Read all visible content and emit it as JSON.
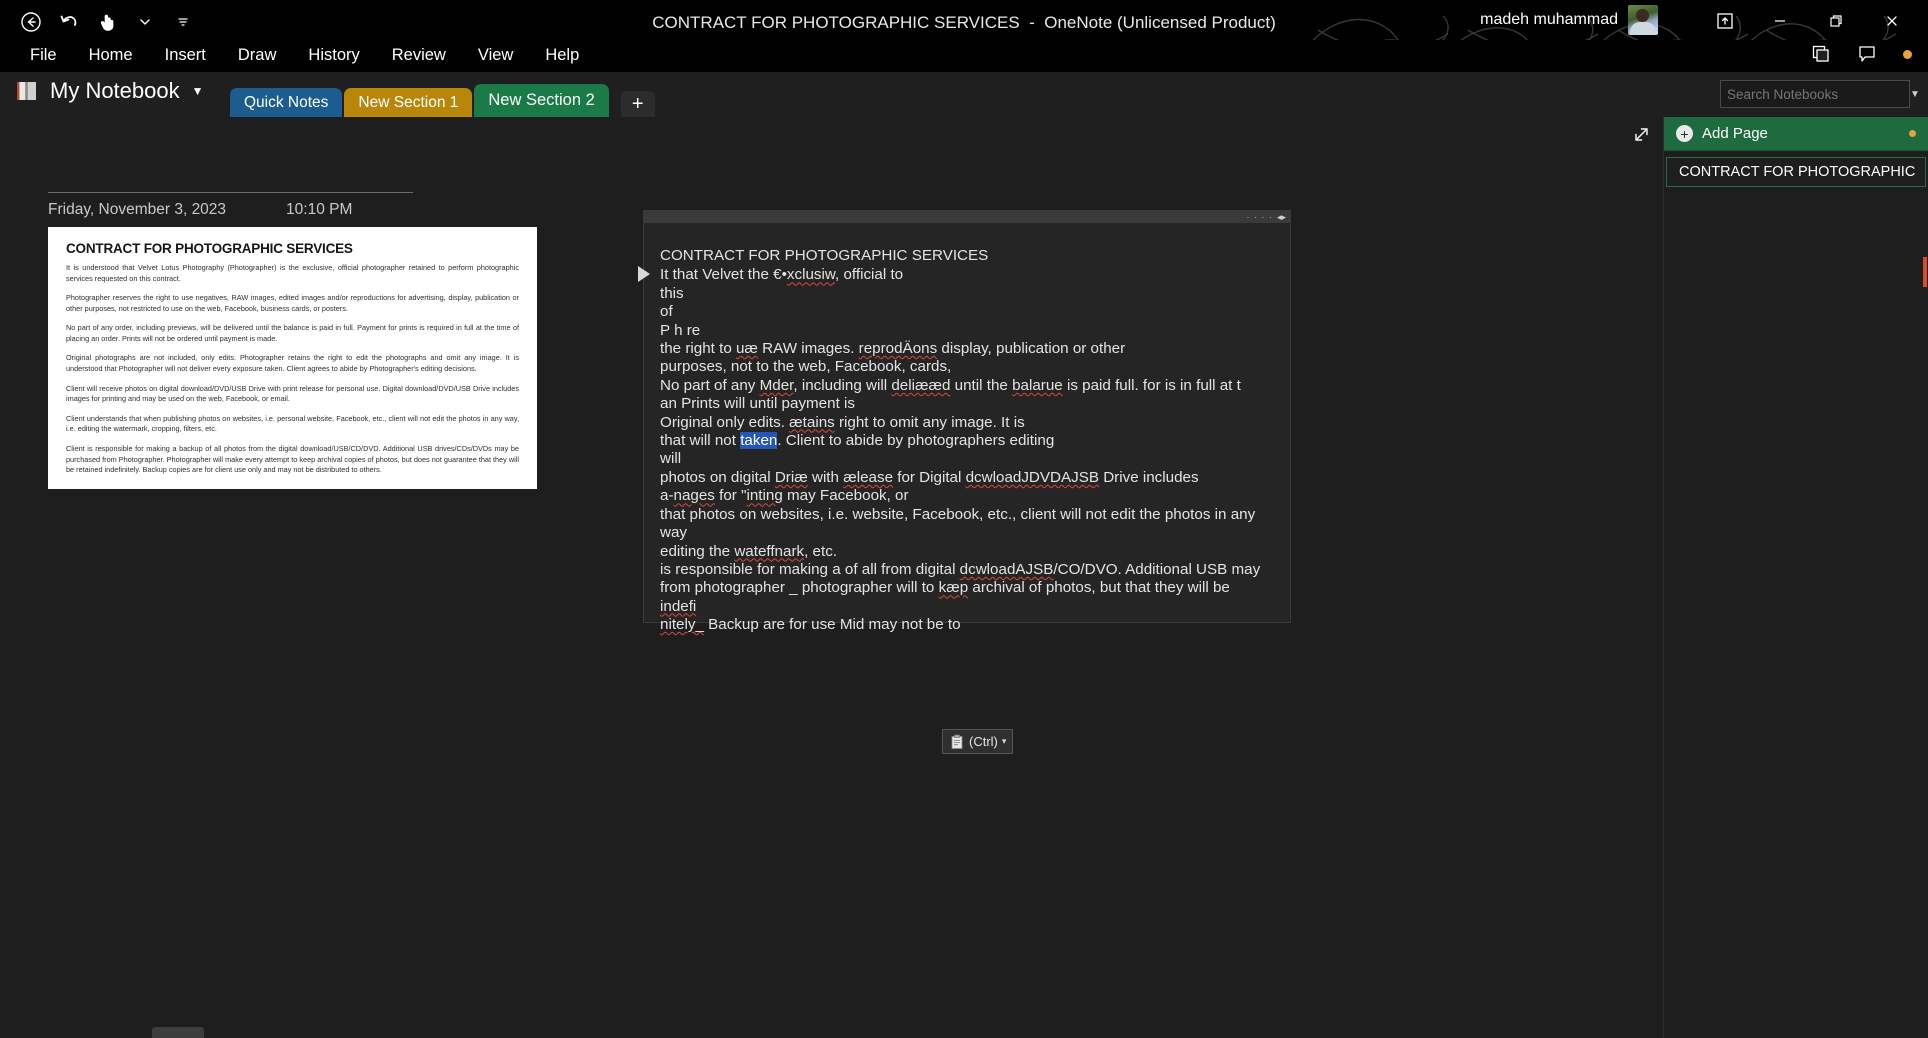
{
  "window": {
    "title": "CONTRACT FOR PHOTOGRAPHIC SERVICES  -  OneNote (Unlicensed Product)",
    "account_name": "madeh muhammad",
    "minimize_label": "Minimize",
    "restore_label": "Restore Down",
    "close_label": "Close",
    "ribbon_display_label": "Ribbon Display Options"
  },
  "quick_access": {
    "back_label": "Back",
    "undo_label": "Undo",
    "touch_mode_label": "Touch/Mouse Mode",
    "touch_caret_label": "Touch Mode Options",
    "customize_label": "Customize Quick Access Toolbar"
  },
  "menu": {
    "items": [
      {
        "label": "File"
      },
      {
        "label": "Home"
      },
      {
        "label": "Insert"
      },
      {
        "label": "Draw"
      },
      {
        "label": "History"
      },
      {
        "label": "Review"
      },
      {
        "label": "View"
      },
      {
        "label": "Help"
      }
    ]
  },
  "top_right_icons": {
    "share_label": "Share",
    "comments_label": "Comments",
    "status_dot_color": "#e8a33d"
  },
  "notebook": {
    "name": "My Notebook",
    "caret": "▼"
  },
  "sections": [
    {
      "label": "Quick Notes",
      "color": "#1c5c8e",
      "active": false
    },
    {
      "label": "New Section 1",
      "color": "#b8860b",
      "active": false
    },
    {
      "label": "New Section 2",
      "color": "#1a7a48",
      "active": true
    }
  ],
  "add_section_label": "+",
  "search": {
    "placeholder": "Search Notebooks",
    "value": "",
    "icon": "search-icon",
    "caret": "▼"
  },
  "page": {
    "date": "Friday, November 3, 2023",
    "time": "10:10 PM",
    "expand_label": "Expand Page"
  },
  "document_image": {
    "heading": "CONTRACT FOR PHOTOGRAPHIC SERVICES",
    "paragraphs": [
      "It is understood that Velvet Lotus Photography (Photographer) is the exclusive, official photographer retained to perform photographic services requested on this contract.",
      "Photographer reserves the right to use negatives, RAW images, edited images and/or reproductions for advertising, display, publication or other purposes, not restricted to use on the web, Facebook, business cards, or posters.",
      "No part of any order, including previews, will be delivered until the balance is paid in full. Payment for prints is required in full at the time of placing an order. Prints will not be ordered until payment is made.",
      "Original photographs are not included, only edits. Photographer retains the right to edit the photographs and omit any image. It is understood that Photographer will not deliver every exposure taken. Client agrees to abide by Photographer's editing decisions.",
      "Client will receive photos on digital download/DVD/USB Drive with print release for personal use. Digital download/DVD/USB Drive includes images for printing and may be used on the web, Facebook, or email.",
      "Client understands that when publishing photos on websites, i.e. personal website, Facebook, etc., client will not edit the photos in any way, i.e. editing the watermark, cropping, filters, etc.",
      "Client is responsible for making a backup of all photos from the digital download/USB/CD/DVD. Additional USB drives/CDs/DVDs may be purchased from Photographer. Photographer will make every attempt to keep archival copies of photos, but does not guarantee that they will be retained indefinitely. Backup copies are for client use only and may not be distributed to others."
    ]
  },
  "ocr_note": {
    "handle_dots": "· · · ·",
    "lines": [
      [
        {
          "t": "CONTRACT FOR PHOTOGRAPHIC SERVICES"
        }
      ],
      [
        {
          "t": "It that Velvet the €•"
        },
        {
          "t": "xclusiw",
          "s": "sq"
        },
        {
          "t": ", official to"
        }
      ],
      [
        {
          "t": "this"
        }
      ],
      [
        {
          "t": "of"
        }
      ],
      [
        {
          "t": "P h re"
        }
      ],
      [
        {
          "t": "the right to "
        },
        {
          "t": "uæ",
          "s": "sq"
        },
        {
          "t": " RAW images. "
        },
        {
          "t": "reprodÄons",
          "s": "sq"
        },
        {
          "t": " display, publication or other"
        }
      ],
      [
        {
          "t": "purposes, not to the web, Facebook, cards,"
        }
      ],
      [
        {
          "t": "No part of any "
        },
        {
          "t": "Mder",
          "s": "sq"
        },
        {
          "t": ", including will "
        },
        {
          "t": "deliææd",
          "s": "sq"
        },
        {
          "t": " until the "
        },
        {
          "t": "balarue",
          "s": "sq"
        },
        {
          "t": " is paid full. for is in full at t"
        }
      ],
      [
        {
          "t": "an Prints will until payment is"
        }
      ],
      [
        {
          "t": "Original only edits. "
        },
        {
          "t": "ætains",
          "s": "sq"
        },
        {
          "t": " right to omit any image. It is"
        }
      ],
      [
        {
          "t": "that will not "
        },
        {
          "t": "taken",
          "s": "sel"
        },
        {
          "t": ". Client to abide by photographers editing"
        }
      ],
      [
        {
          "t": "will"
        }
      ],
      [
        {
          "t": "photos on digital "
        },
        {
          "t": "Driæ",
          "s": "sq"
        },
        {
          "t": " with "
        },
        {
          "t": "ælease",
          "s": "sq"
        },
        {
          "t": " for Digital "
        },
        {
          "t": "dcwloadJDVDAJSB",
          "s": "sq"
        },
        {
          "t": " Drive includes"
        }
      ],
      [
        {
          "t": "a-"
        },
        {
          "t": "nages",
          "s": "sq"
        },
        {
          "t": " for \""
        },
        {
          "t": "inting",
          "s": "sq"
        },
        {
          "t": " may Facebook, or"
        }
      ],
      [
        {
          "t": "that photos on websites, i.e. website, Facebook, etc., client will not edit the photos in any way"
        }
      ],
      [
        {
          "t": "editing the "
        },
        {
          "t": "wateffnark",
          "s": "sq"
        },
        {
          "t": ", etc."
        }
      ],
      [
        {
          "t": "is responsible for making a of all from digital "
        },
        {
          "t": "dcwloadAJSB",
          "s": "sq"
        },
        {
          "t": "/CO/DVO. Additional USB may"
        }
      ],
      [
        {
          "t": "from photographer _ photographer will to "
        },
        {
          "t": "kæp",
          "s": "sq"
        },
        {
          "t": " archival of photos, but that they will be"
        }
      ],
      [
        {
          "t": "indefi",
          "s": "sq"
        }
      ],
      [
        {
          "t": "nitely_",
          "s": "sq"
        },
        {
          "t": " Backup are for use Mid may not be to"
        }
      ]
    ]
  },
  "paste_options": {
    "label": "(Ctrl)",
    "icon": "clipboard-icon",
    "caret": "▾"
  },
  "page_pane": {
    "add_page_label": "Add Page",
    "add_page_plus": "+",
    "status_dot_color": "#d79a33",
    "pages": [
      {
        "title": "CONTRACT FOR PHOTOGRAPHIC"
      }
    ]
  }
}
